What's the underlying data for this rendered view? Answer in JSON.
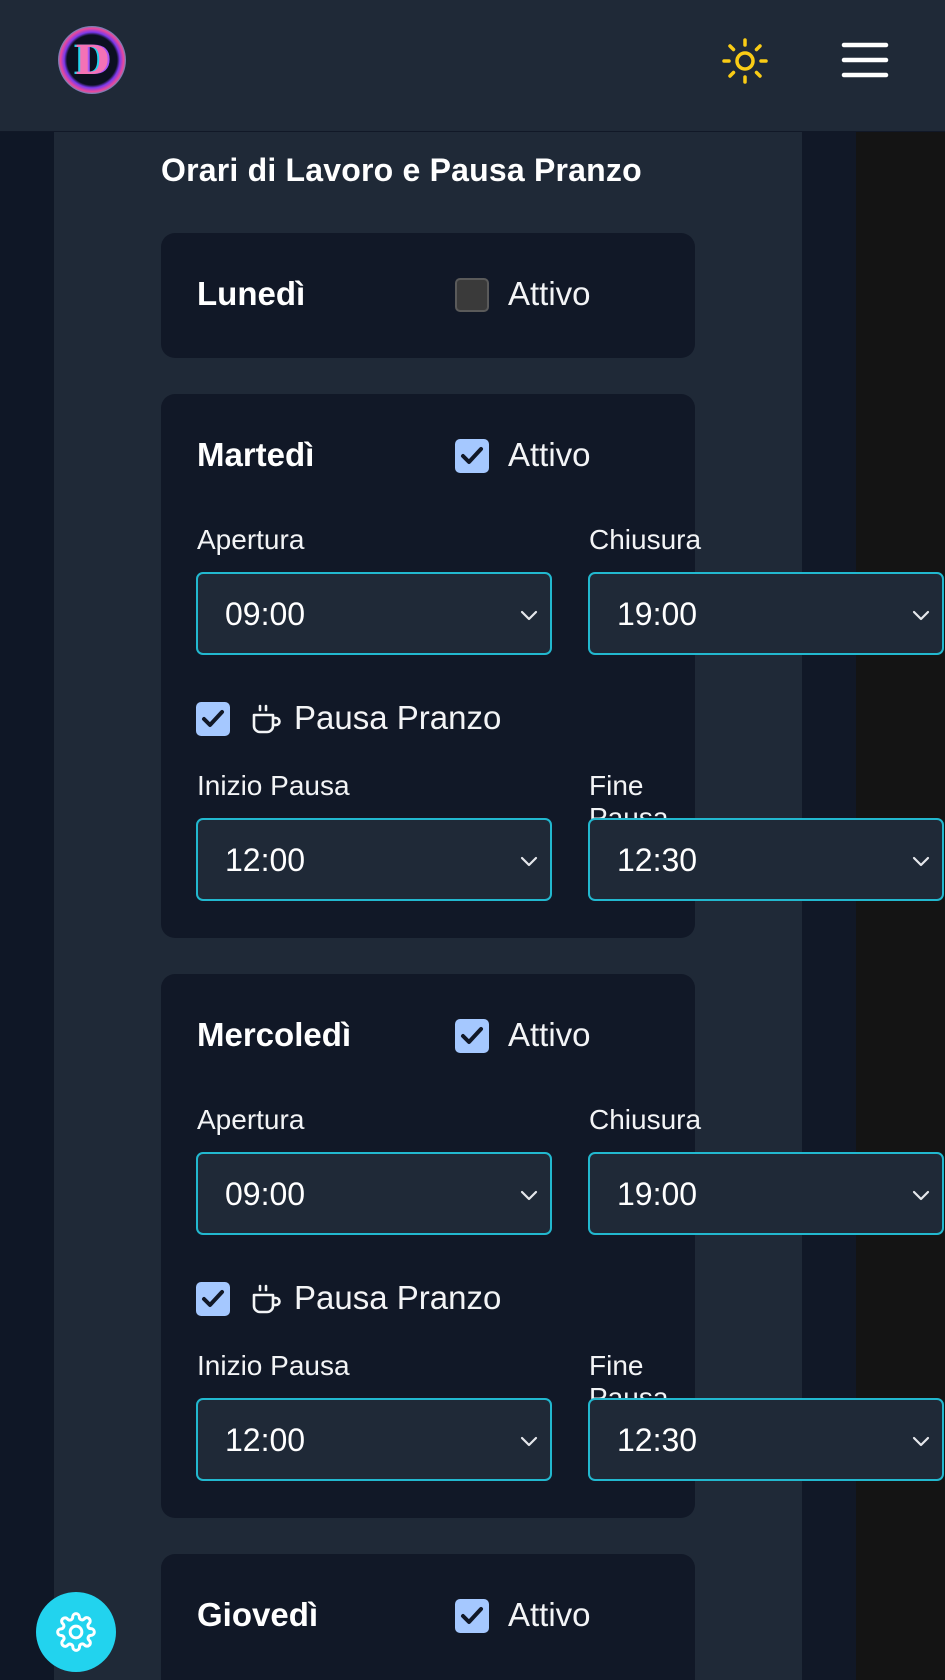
{
  "header": {
    "logo_letter": "D",
    "theme_icon": "sun-icon",
    "menu_icon": "hamburger-menu-icon"
  },
  "section_title": "Orari di Lavoro e Pausa Pranzo",
  "labels": {
    "active": "Attivo",
    "opening": "Apertura",
    "closing": "Chiusura",
    "lunch_break": "Pausa Pranzo",
    "break_start": "Inizio Pausa",
    "break_end": "Fine Pausa"
  },
  "days": [
    {
      "name": "Lunedì",
      "active": false
    },
    {
      "name": "Martedì",
      "active": true,
      "opening": "09:00",
      "closing": "19:00",
      "lunch_break": true,
      "break_start": "12:00",
      "break_end": "12:30"
    },
    {
      "name": "Mercoledì",
      "active": true,
      "opening": "09:00",
      "closing": "19:00",
      "lunch_break": true,
      "break_start": "12:00",
      "break_end": "12:30"
    },
    {
      "name": "Giovedì",
      "active": true
    }
  ],
  "fab_icon": "gear-icon",
  "colors": {
    "accent": "#22d3ee",
    "checkbox_checked": "#a5c8ff",
    "sun": "#facc15",
    "card_bg": "#111827",
    "panel_bg": "#1f2937"
  }
}
